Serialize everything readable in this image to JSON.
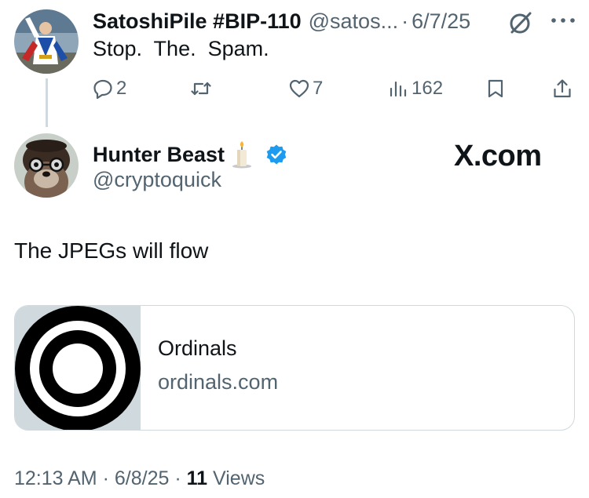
{
  "reply_tweet": {
    "author_name": "SatoshiPile #BIP-110",
    "handle": "@satos...",
    "separator": "·",
    "date": "6/7/25",
    "text": "Stop.  The.  Spam.",
    "avatar_icon": "user-avatar-icon",
    "actions": {
      "reply_count": "2",
      "like_count": "7",
      "views_count": "162"
    }
  },
  "main_tweet": {
    "author_name": "Hunter Beast",
    "handle": "@cryptoquick",
    "watermark": "X.com",
    "text": "The JPEGs will flow",
    "verified_color": "#1d9bf0",
    "link_card": {
      "title": "Ordinals",
      "domain": "ordinals.com"
    },
    "meta": {
      "time": "12:13 AM",
      "sep1": "·",
      "date": "6/8/25",
      "sep2": "·",
      "views_count": "11",
      "views_label": "Views"
    }
  },
  "colors": {
    "text_primary": "#0f1419",
    "text_secondary": "#536471",
    "border": "#cfd9de",
    "accent": "#1d9bf0"
  }
}
